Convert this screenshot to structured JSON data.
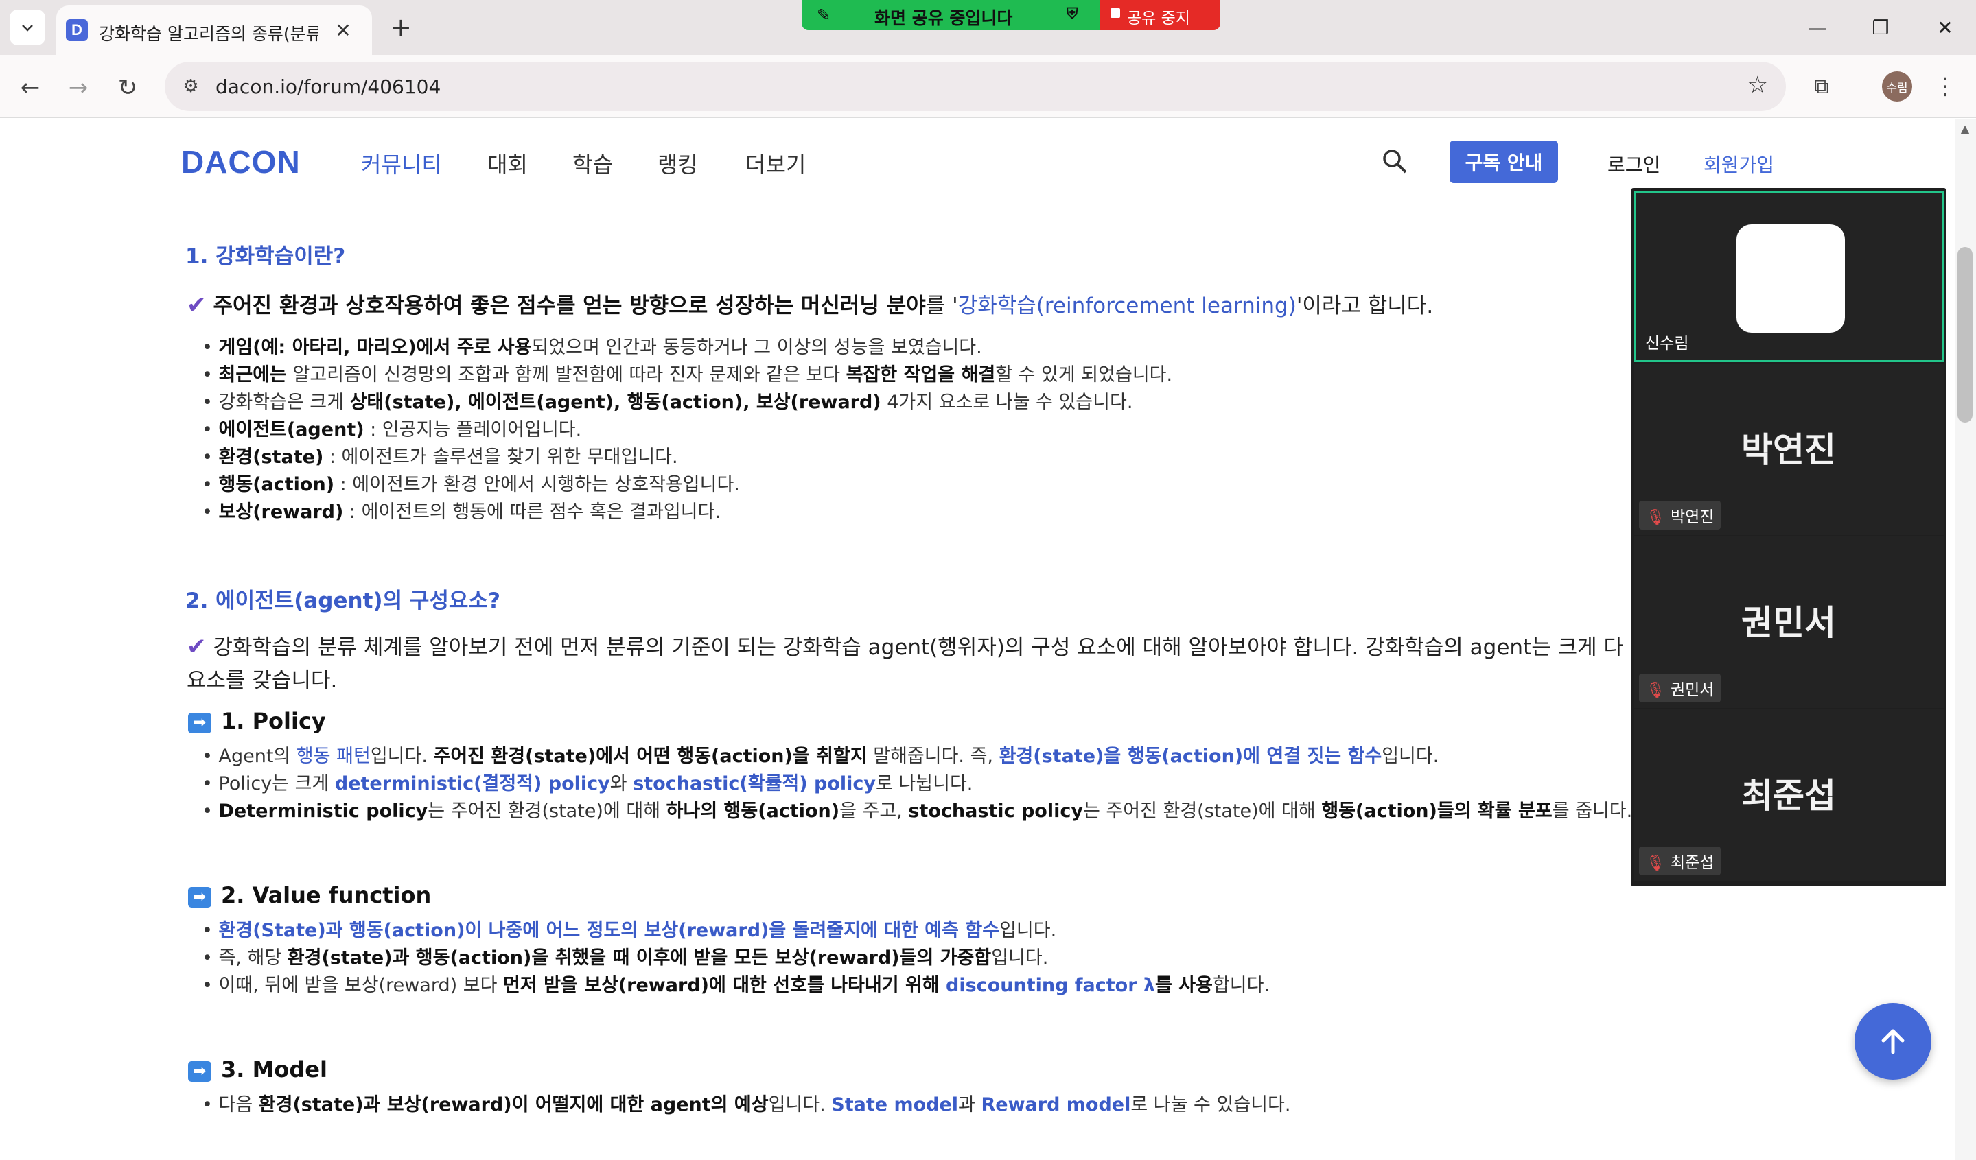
{
  "browser": {
    "tab_title": "강화학습 알고리즘의 종류(분류",
    "tab_favicon": "D",
    "url": "dacon.io/forum/406104",
    "profile_initials": "수림"
  },
  "share_bar": {
    "status": "화면 공유 중입니다",
    "stop_label": "공유 중지"
  },
  "site": {
    "logo": "DACON",
    "nav": [
      "커뮤니티",
      "대회",
      "학습",
      "랭킹",
      "더보기"
    ],
    "subscribe_label": "구독 안내",
    "login_label": "로그인",
    "signup_label": "회원가입",
    "accent": "#4469d8"
  },
  "article": {
    "s1_title": "1. 강화학습이란?",
    "s1_lead_a": "주어진 환경과 상호작용하여 좋은 점수를 얻는 방향으로 성장하는 머신러닝 분야",
    "s1_lead_b": "를 '",
    "s1_lead_link": "강화학습(reinforcement learning)",
    "s1_lead_c": "'이라고 합니다.",
    "s1_b1_bold": "게임(예: 아타리, 마리오)에서 주로 사용",
    "s1_b1_rest": "되었으며 인간과 동등하거나 그 이상의 성능을 보였습니다.",
    "s1_b2_bold1": "최근에는",
    "s1_b2_mid": " 알고리즘이 신경망의 조합과 함께 발전함에 따라 진자 문제와 같은 보다 ",
    "s1_b2_bold2": "복잡한 작업을 해결",
    "s1_b2_rest": "할 수 있게 되었습니다.",
    "s1_b3_pre": "강화학습은 크게 ",
    "s1_b3_bold": "상태(state), 에이전트(agent), 행동(action), 보상(reward)",
    "s1_b3_rest": " 4가지 요소로 나눌 수 있습니다.",
    "s1_b4_bold": "에이전트(agent)",
    "s1_b4_rest": " : 인공지능 플레이어입니다.",
    "s1_b5_bold": "환경(state)",
    "s1_b5_rest": " : 에이전트가 솔루션을 찾기 위한 무대입니다.",
    "s1_b6_bold": "행동(action)",
    "s1_b6_rest": " : 에이전트가 환경 안에서 시행하는 상호작용입니다.",
    "s1_b7_bold": "보상(reward)",
    "s1_b7_rest": " : 에이전트의 행동에 따른 점수 혹은 결과입니다.",
    "s2_title": "2. 에이전트(agent)의 구성요소?",
    "s2_lead_line1": "강화학습의 분류 체계를 알아보기 전에 먼저 분류의 기준이 되는 강화학습 agent(행위자)의 구성 요소에 대해 알아보아야 합니다. 강화학습의 agent는 크게 다",
    "s2_lead_line2": "요소를 갖습니다.",
    "p1_title": "1. Policy",
    "p1_b1_pre": "Agent의 ",
    "p1_b1_link": "행동 패턴",
    "p1_b1_mid": "입니다. ",
    "p1_b1_bold": "주어진 환경(state)에서 어떤 행동(action)을 취할지",
    "p1_b1_mid2": " 말해줍니다. 즉, ",
    "p1_b1_link2": "환경(state)을 행동(action)에 연결 짓는 함수",
    "p1_b1_rest": "입니다.",
    "p1_b2_pre": "Policy는 크게 ",
    "p1_b2_link1": "deterministic(결정적) policy",
    "p1_b2_mid": "와 ",
    "p1_b2_link2": "stochastic(확률적) policy",
    "p1_b2_rest": "로 나뉩니다.",
    "p1_b3_bold1": "Deterministic policy",
    "p1_b3_t1": "는 주어진 환경(state)에 대해 ",
    "p1_b3_bold2": "하나의 행동(action)",
    "p1_b3_t2": "을 주고, ",
    "p1_b3_bold3": "stochastic policy",
    "p1_b3_t3": "는 주어진 환경(state)에 대해 ",
    "p1_b3_bold4": "행동(action)들의 확률 분포",
    "p1_b3_t4": "를 줍니다.",
    "p2_title": "2. Value function",
    "p2_b1_link": "환경(State)과 행동(action)이 나중에 어느 정도의 보상(reward)을 돌려줄지에 대한 예측 함수",
    "p2_b1_rest": "입니다.",
    "p2_b2_pre": "즉, 해당 ",
    "p2_b2_bold": "환경(state)과 행동(action)을 취했을 때 이후에 받을 모든 보상(reward)들의 가중합",
    "p2_b2_rest": "입니다.",
    "p2_b3_pre": "이때, 뒤에 받을 보상(reward) 보다 ",
    "p2_b3_bold": "먼저 받을 보상(reward)에 대한 선호를 나타내기 위해 ",
    "p2_b3_link": "discounting factor λ",
    "p2_b3_bold2": "를 사용",
    "p2_b3_rest": "합니다.",
    "p3_title": "3. Model",
    "p3_b1_pre": "다음 ",
    "p3_b1_bold": "환경(state)과 보상(reward)이 어떨지에 대한 agent의 예상",
    "p3_b1_mid": "입니다. ",
    "p3_b1_link1": "State model",
    "p3_b1_mid2": "과 ",
    "p3_b1_link2": "Reward model",
    "p3_b1_rest": "로 나눌 수 있습니다."
  },
  "video_call": {
    "self_name": "신수림",
    "participants": [
      {
        "name": "박연진",
        "label": "박연진"
      },
      {
        "name": "권민서",
        "label": "권민서"
      },
      {
        "name": "최준섭",
        "label": "최준섭"
      }
    ]
  },
  "icons": {
    "back": "arrow-left-icon",
    "forward": "arrow-right-icon",
    "reload": "reload-icon",
    "scroll_top": "arrow-up-icon",
    "mic_off": "mic-off-icon"
  }
}
